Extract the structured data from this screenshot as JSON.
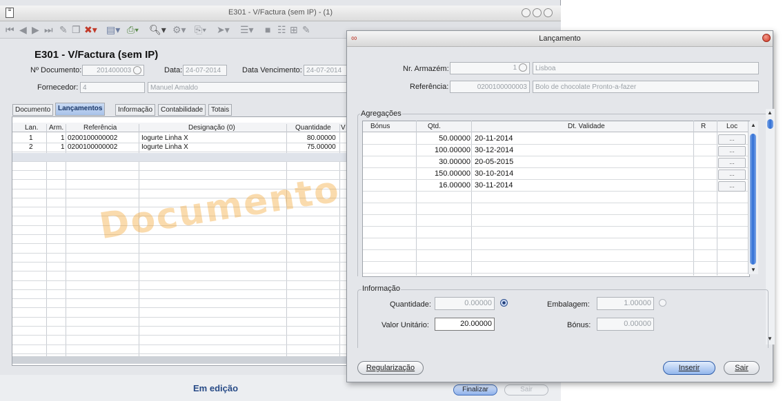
{
  "main_window": {
    "title": "E301 - V/Factura (sem IP) - (1)",
    "heading": "E301 - V/Factura (sem IP)",
    "doc_label": "Nº Documento:",
    "doc_value": "201400003",
    "data_label": "Data:",
    "data_value": "24-07-2014",
    "venc_label": "Data Vencimento:",
    "venc_value": "24-07-2014",
    "forn_label": "Fornecedor:",
    "forn_code": "4",
    "forn_name": "Manuel Amaldo",
    "tabs": [
      "Documento",
      "Lançamentos",
      "Informação",
      "Contabilidade",
      "Totais"
    ],
    "grid_headers": [
      "Lan.",
      "Arm.",
      "Referência",
      "Designação (0)",
      "Quantidade",
      "V"
    ],
    "rows": [
      {
        "lan": "1",
        "arm": "1",
        "ref": "0200100000002",
        "desig": "Iogurte Linha X",
        "qtd": "80.00000"
      },
      {
        "lan": "2",
        "arm": "1",
        "ref": "0200100000002",
        "desig": "Iogurte Linha X",
        "qtd": "75.00000"
      }
    ],
    "watermark": "Documento em",
    "status": "Em edição",
    "finalizar": "Finalizar",
    "sair": "Sair"
  },
  "dialog": {
    "title": "Lançamento",
    "armazem_label": "Nr. Armazém:",
    "armazem_value": "1",
    "armazem_name": "Lisboa",
    "ref_label": "Referência:",
    "ref_value": "0200100000003",
    "ref_name": "Bolo de chocolate Pronto-a-fazer",
    "agg_title": "Agregações",
    "agg_headers": [
      "Bónus",
      "Qtd.",
      "Dt. Validade",
      "R",
      "Loc"
    ],
    "agg_rows": [
      {
        "qtd": "50.00000",
        "date": "20-11-2014",
        "loc": "..."
      },
      {
        "qtd": "100.00000",
        "date": "30-12-2014",
        "loc": "..."
      },
      {
        "qtd": "30.00000",
        "date": "20-05-2015",
        "loc": "..."
      },
      {
        "qtd": "150.00000",
        "date": "30-10-2014",
        "loc": "..."
      },
      {
        "qtd": "16.00000",
        "date": "30-11-2014",
        "loc": "..."
      }
    ],
    "info_title": "Informação",
    "quant_label": "Quantidade:",
    "quant_value": "0.00000",
    "emb_label": "Embalagem:",
    "emb_value": "1.00000",
    "valor_label": "Valor Unitário:",
    "valor_value": "20.00000",
    "bonus_label": "Bónus:",
    "bonus_value": "0.00000",
    "regularizacao": "Regularização",
    "inserir": "Inserir",
    "sair": "Sair"
  },
  "colors": {
    "accent": "#2f6fd6",
    "tab_active": "#a9c3ea",
    "watermark": "#f3a028",
    "status_text": "#274a86"
  }
}
